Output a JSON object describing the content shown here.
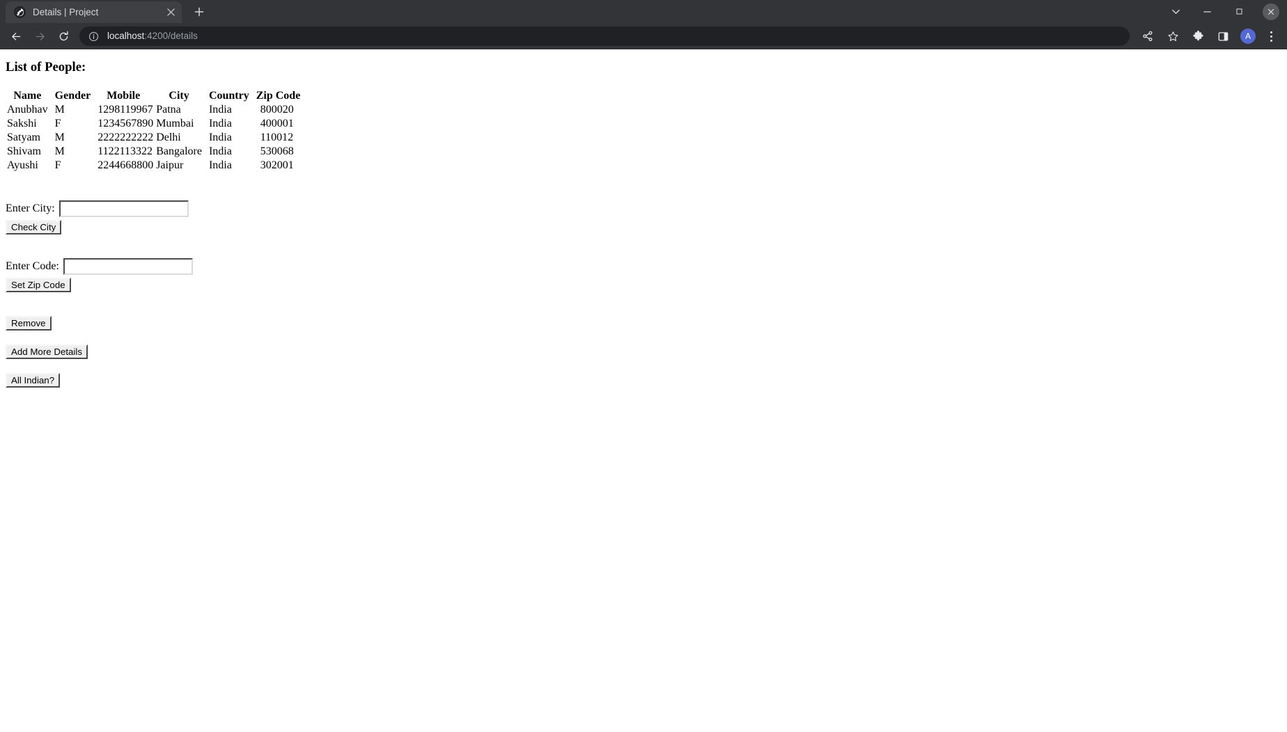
{
  "window": {
    "controls": [
      {
        "name": "tab-search-chevron",
        "icon": "chevron-down-icon",
        "label": "Search tabs"
      },
      {
        "name": "minimize",
        "icon": "minimize-icon",
        "label": "Minimize"
      },
      {
        "name": "maximize",
        "icon": "maximize-icon",
        "label": "Maximize"
      },
      {
        "name": "close",
        "icon": "close-icon",
        "label": "Close"
      }
    ]
  },
  "tabstrip": {
    "tabs": [
      {
        "title": "Details | Project",
        "favicon": "globe-icon",
        "close_label": "×",
        "active": true
      }
    ],
    "new_tab_label": "+"
  },
  "toolbar": {
    "back_label": "←",
    "forward_label": "→",
    "reload_label": "↻",
    "omnibox": {
      "info_icon": "info-circle-icon",
      "host": "localhost",
      "path": ":4200/details",
      "full_url": "localhost:4200/details"
    },
    "actions": [
      {
        "name": "share-icon",
        "label": "Share"
      },
      {
        "name": "bookmark-star-icon",
        "label": "Bookmark this tab"
      },
      {
        "name": "extensions-puzzle-icon",
        "label": "Extensions"
      },
      {
        "name": "side-panel-icon",
        "label": "Side panel"
      }
    ],
    "avatar_initial": "A",
    "menu_label": "Customize and control Google Chrome"
  },
  "page": {
    "title": "List of People:",
    "table": {
      "columns": [
        "Name",
        "Gender",
        "Mobile",
        "City",
        "Country",
        "Zip Code"
      ],
      "rows": [
        {
          "name": "Anubhav",
          "gender": "M",
          "mobile": "1298119967",
          "city": "Patna",
          "country": "India",
          "zip": "800020"
        },
        {
          "name": "Sakshi",
          "gender": "F",
          "mobile": "1234567890",
          "city": "Mumbai",
          "country": "India",
          "zip": "400001"
        },
        {
          "name": "Satyam",
          "gender": "M",
          "mobile": "2222222222",
          "city": "Delhi",
          "country": "India",
          "zip": "110012"
        },
        {
          "name": "Shivam",
          "gender": "M",
          "mobile": "1122113322",
          "city": "Bangalore",
          "country": "India",
          "zip": "530068"
        },
        {
          "name": "Ayushi",
          "gender": "F",
          "mobile": "2244668800",
          "city": "Jaipur",
          "country": "India",
          "zip": "302001"
        }
      ]
    },
    "forms": {
      "city": {
        "label": "Enter City:",
        "value": "",
        "placeholder": "",
        "button_label": "Check City"
      },
      "code": {
        "label": "Enter Code:",
        "value": "",
        "placeholder": "",
        "button_label": "Set Zip Code"
      }
    },
    "buttons": {
      "remove_label": "Remove",
      "add_more_label": "Add More Details",
      "all_indian_label": "All Indian?"
    }
  },
  "colors": {
    "chrome_bg": "#333438",
    "tab_active_bg": "#3f4044",
    "omnibox_bg": "#202124",
    "text_light": "#e8eaed",
    "text_dim": "#9aa0a6",
    "avatar_bg": "#5468d4",
    "page_bg": "#ffffff",
    "page_text": "#000000"
  }
}
